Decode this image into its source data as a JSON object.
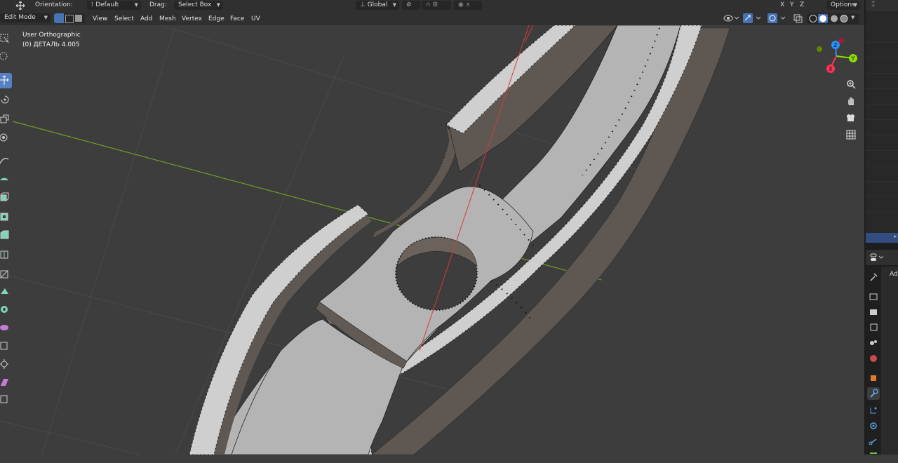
{
  "topbar": {
    "orientation_label": "Orientation:",
    "orientation_value": "Default",
    "drag_label": "Drag:",
    "drag_value": "Select Box",
    "transform_space": "Global",
    "options_label": "Options",
    "axis_x": "X",
    "axis_y": "Y",
    "axis_z": "Z"
  },
  "header": {
    "mode": "Edit Mode",
    "menus": [
      "View",
      "Select",
      "Add",
      "Mesh",
      "Vertex",
      "Edge",
      "Face",
      "UV"
    ]
  },
  "viewport": {
    "view_name": "User Orthographic",
    "object_info": "(0) ДЕТАЛЬ 4.005"
  },
  "gizmo": {
    "x": "X",
    "y": "Y",
    "z": "Z"
  },
  "properties": {
    "partial_label": "Ad"
  },
  "colors": {
    "background": "#3d3d3d",
    "header": "#303030",
    "active_tool": "#5680c2",
    "x_axis": "#ff3352",
    "y_axis": "#8bdc00",
    "z_axis": "#2890ff",
    "mesh_face": "#b4b4b4",
    "mesh_wall": "#5d5650"
  },
  "icons": [
    "select-box-icon",
    "cursor-icon",
    "move-icon",
    "rotate-icon",
    "scale-icon",
    "transform-icon",
    "annotate-icon",
    "measure-icon",
    "extrude-icon",
    "inset-icon",
    "bevel-icon",
    "loop-cut-icon",
    "knife-icon",
    "poly-build-icon",
    "spin-icon",
    "smooth-icon",
    "edge-slide-icon",
    "shrink-icon",
    "shear-icon",
    "rip-icon",
    "zoom-icon",
    "pan-hand-icon",
    "camera-icon",
    "grid-icon"
  ]
}
